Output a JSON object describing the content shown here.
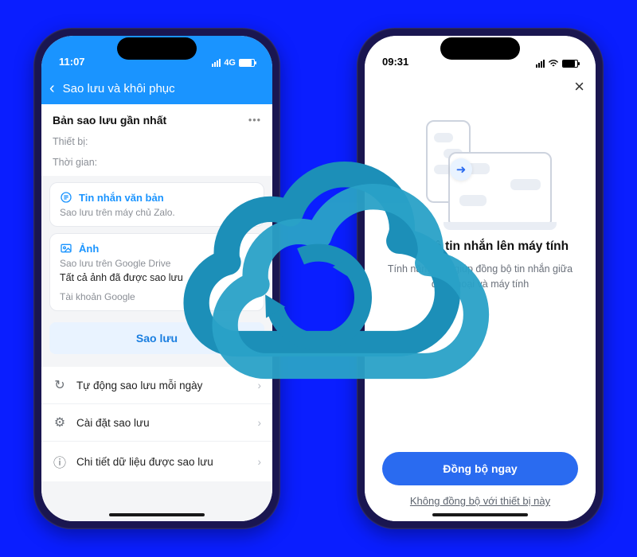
{
  "left": {
    "status": {
      "time": "11:07",
      "net": "4G"
    },
    "topbar": {
      "title": "Sao lưu và khôi phục"
    },
    "section_title": "Bản sao lưu gần nhất",
    "device_label": "Thiết bị:",
    "time_label": "Thời gian:",
    "card_text": {
      "title": "Tin nhắn văn bản",
      "sub": "Sao lưu trên máy chủ Zalo."
    },
    "card_photo": {
      "title": "Ảnh",
      "sub": "Sao lưu trên Google Drive",
      "line": "Tất cả ảnh đã được sao lưu",
      "account_label": "Tài khoản Google"
    },
    "backup_button": "Sao lưu",
    "options": {
      "auto": "Tự động sao lưu mỗi ngày",
      "settings": "Cài đặt sao lưu",
      "details": "Chi tiết dữ liệu được sao lưu"
    }
  },
  "right": {
    "status": {
      "time": "09:31"
    },
    "title": "Đồng bộ tin nhắn lên máy tính",
    "subtitle": "Tính năng này giúp đồng bộ tin nhắn giữa điện thoại và máy tính",
    "primary_button": "Đồng bộ ngay",
    "secondary_link": "Không đồng bộ với thiết bị này"
  },
  "colors": {
    "brand_blue": "#1a94ff",
    "accent_blue": "#2a6bf0",
    "cloud": "#1c8fb8"
  }
}
